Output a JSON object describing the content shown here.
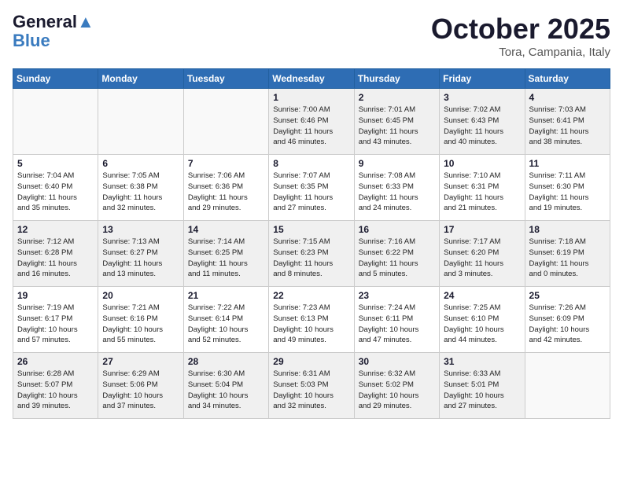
{
  "header": {
    "logo_line1": "General",
    "logo_line2": "Blue",
    "month": "October 2025",
    "location": "Tora, Campania, Italy"
  },
  "weekdays": [
    "Sunday",
    "Monday",
    "Tuesday",
    "Wednesday",
    "Thursday",
    "Friday",
    "Saturday"
  ],
  "weeks": [
    [
      {
        "day": "",
        "info": ""
      },
      {
        "day": "",
        "info": ""
      },
      {
        "day": "",
        "info": ""
      },
      {
        "day": "1",
        "info": "Sunrise: 7:00 AM\nSunset: 6:46 PM\nDaylight: 11 hours\nand 46 minutes."
      },
      {
        "day": "2",
        "info": "Sunrise: 7:01 AM\nSunset: 6:45 PM\nDaylight: 11 hours\nand 43 minutes."
      },
      {
        "day": "3",
        "info": "Sunrise: 7:02 AM\nSunset: 6:43 PM\nDaylight: 11 hours\nand 40 minutes."
      },
      {
        "day": "4",
        "info": "Sunrise: 7:03 AM\nSunset: 6:41 PM\nDaylight: 11 hours\nand 38 minutes."
      }
    ],
    [
      {
        "day": "5",
        "info": "Sunrise: 7:04 AM\nSunset: 6:40 PM\nDaylight: 11 hours\nand 35 minutes."
      },
      {
        "day": "6",
        "info": "Sunrise: 7:05 AM\nSunset: 6:38 PM\nDaylight: 11 hours\nand 32 minutes."
      },
      {
        "day": "7",
        "info": "Sunrise: 7:06 AM\nSunset: 6:36 PM\nDaylight: 11 hours\nand 29 minutes."
      },
      {
        "day": "8",
        "info": "Sunrise: 7:07 AM\nSunset: 6:35 PM\nDaylight: 11 hours\nand 27 minutes."
      },
      {
        "day": "9",
        "info": "Sunrise: 7:08 AM\nSunset: 6:33 PM\nDaylight: 11 hours\nand 24 minutes."
      },
      {
        "day": "10",
        "info": "Sunrise: 7:10 AM\nSunset: 6:31 PM\nDaylight: 11 hours\nand 21 minutes."
      },
      {
        "day": "11",
        "info": "Sunrise: 7:11 AM\nSunset: 6:30 PM\nDaylight: 11 hours\nand 19 minutes."
      }
    ],
    [
      {
        "day": "12",
        "info": "Sunrise: 7:12 AM\nSunset: 6:28 PM\nDaylight: 11 hours\nand 16 minutes."
      },
      {
        "day": "13",
        "info": "Sunrise: 7:13 AM\nSunset: 6:27 PM\nDaylight: 11 hours\nand 13 minutes."
      },
      {
        "day": "14",
        "info": "Sunrise: 7:14 AM\nSunset: 6:25 PM\nDaylight: 11 hours\nand 11 minutes."
      },
      {
        "day": "15",
        "info": "Sunrise: 7:15 AM\nSunset: 6:23 PM\nDaylight: 11 hours\nand 8 minutes."
      },
      {
        "day": "16",
        "info": "Sunrise: 7:16 AM\nSunset: 6:22 PM\nDaylight: 11 hours\nand 5 minutes."
      },
      {
        "day": "17",
        "info": "Sunrise: 7:17 AM\nSunset: 6:20 PM\nDaylight: 11 hours\nand 3 minutes."
      },
      {
        "day": "18",
        "info": "Sunrise: 7:18 AM\nSunset: 6:19 PM\nDaylight: 11 hours\nand 0 minutes."
      }
    ],
    [
      {
        "day": "19",
        "info": "Sunrise: 7:19 AM\nSunset: 6:17 PM\nDaylight: 10 hours\nand 57 minutes."
      },
      {
        "day": "20",
        "info": "Sunrise: 7:21 AM\nSunset: 6:16 PM\nDaylight: 10 hours\nand 55 minutes."
      },
      {
        "day": "21",
        "info": "Sunrise: 7:22 AM\nSunset: 6:14 PM\nDaylight: 10 hours\nand 52 minutes."
      },
      {
        "day": "22",
        "info": "Sunrise: 7:23 AM\nSunset: 6:13 PM\nDaylight: 10 hours\nand 49 minutes."
      },
      {
        "day": "23",
        "info": "Sunrise: 7:24 AM\nSunset: 6:11 PM\nDaylight: 10 hours\nand 47 minutes."
      },
      {
        "day": "24",
        "info": "Sunrise: 7:25 AM\nSunset: 6:10 PM\nDaylight: 10 hours\nand 44 minutes."
      },
      {
        "day": "25",
        "info": "Sunrise: 7:26 AM\nSunset: 6:09 PM\nDaylight: 10 hours\nand 42 minutes."
      }
    ],
    [
      {
        "day": "26",
        "info": "Sunrise: 6:28 AM\nSunset: 5:07 PM\nDaylight: 10 hours\nand 39 minutes."
      },
      {
        "day": "27",
        "info": "Sunrise: 6:29 AM\nSunset: 5:06 PM\nDaylight: 10 hours\nand 37 minutes."
      },
      {
        "day": "28",
        "info": "Sunrise: 6:30 AM\nSunset: 5:04 PM\nDaylight: 10 hours\nand 34 minutes."
      },
      {
        "day": "29",
        "info": "Sunrise: 6:31 AM\nSunset: 5:03 PM\nDaylight: 10 hours\nand 32 minutes."
      },
      {
        "day": "30",
        "info": "Sunrise: 6:32 AM\nSunset: 5:02 PM\nDaylight: 10 hours\nand 29 minutes."
      },
      {
        "day": "31",
        "info": "Sunrise: 6:33 AM\nSunset: 5:01 PM\nDaylight: 10 hours\nand 27 minutes."
      },
      {
        "day": "",
        "info": ""
      }
    ]
  ]
}
